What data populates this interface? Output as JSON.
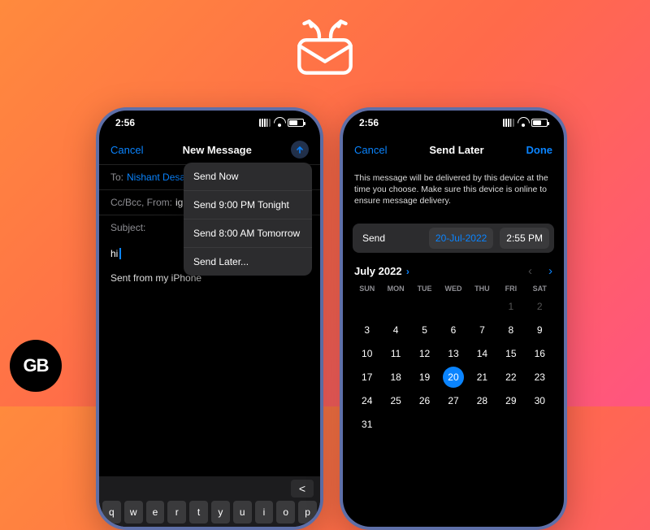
{
  "hero_icon_name": "schedule-mail-icon",
  "gb_badge": "GB",
  "statusbar": {
    "time": "2:56"
  },
  "phone_left": {
    "nav": {
      "cancel": "Cancel",
      "title": "New Message"
    },
    "fields": {
      "to_label": "To:",
      "to_value": "Nishant Desa",
      "cc_label": "Cc/Bcc, From:",
      "cc_value": "ig",
      "subject_label": "Subject:"
    },
    "body_text": "hi",
    "signature": "Sent from my iPhone",
    "popup": {
      "items": [
        "Send Now",
        "Send 9:00 PM Tonight",
        "Send 8:00 AM Tomorrow",
        "Send Later..."
      ]
    },
    "keyboard_row": [
      "q",
      "w",
      "e",
      "r",
      "t",
      "y",
      "u",
      "i",
      "o",
      "p"
    ]
  },
  "phone_right": {
    "nav": {
      "cancel": "Cancel",
      "title": "Send Later",
      "done": "Done"
    },
    "notice": "This message will be delivered by this device at the time you choose. Make sure this device is online to ensure message delivery.",
    "send_row": {
      "label": "Send",
      "date": "20-Jul-2022",
      "time": "2:55 PM"
    },
    "calendar": {
      "month_label": "July 2022",
      "dow": [
        "SUN",
        "MON",
        "TUE",
        "WED",
        "THU",
        "FRI",
        "SAT"
      ],
      "leading_blanks": 5,
      "dim_days": [
        1,
        2
      ],
      "days_total": 31,
      "selected": 20
    }
  }
}
